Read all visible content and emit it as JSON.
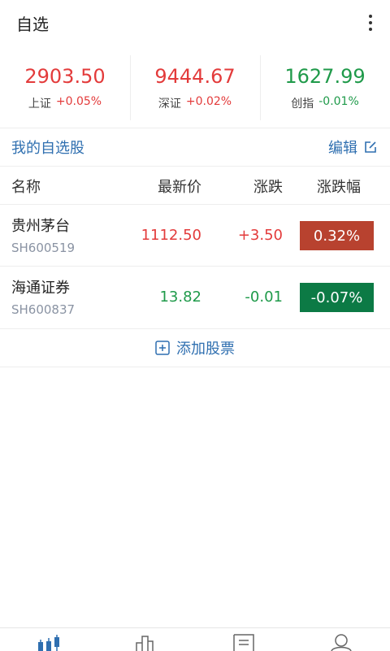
{
  "header": {
    "title": "自选",
    "more_icon": "more-vertical-icon"
  },
  "indices": [
    {
      "name": "上证",
      "value": "2903.50",
      "change": "+0.05%",
      "direction": "up"
    },
    {
      "name": "深证",
      "value": "9444.67",
      "change": "+0.02%",
      "direction": "up"
    },
    {
      "name": "创指",
      "value": "1627.99",
      "change": "-0.01%",
      "direction": "down"
    }
  ],
  "watchlist": {
    "title": "我的自选股",
    "edit_label": "编辑",
    "edit_icon": "edit-icon",
    "columns": [
      "名称",
      "最新价",
      "涨跌",
      "涨跌幅"
    ],
    "rows": [
      {
        "name": "贵州茅台",
        "code": "SH600519",
        "price": "1112.50",
        "change": "+3.50",
        "pct": "0.32%",
        "direction": "up"
      },
      {
        "name": "海通证券",
        "code": "SH600837",
        "price": "13.82",
        "change": "-0.01",
        "pct": "-0.07%",
        "direction": "down"
      }
    ],
    "add_label": "添加股票",
    "add_icon": "plus-square-icon"
  },
  "tabbar": [
    {
      "icon": "candlestick-icon",
      "active": true
    },
    {
      "icon": "bar-chart-icon",
      "active": false
    },
    {
      "icon": "news-icon",
      "active": false
    },
    {
      "icon": "user-icon",
      "active": false
    }
  ],
  "colors": {
    "up": "#e33b3b",
    "down": "#1f9a4a",
    "up_badge": "#b8422f",
    "down_badge": "#0c7a45",
    "accent": "#2f6fb0"
  }
}
